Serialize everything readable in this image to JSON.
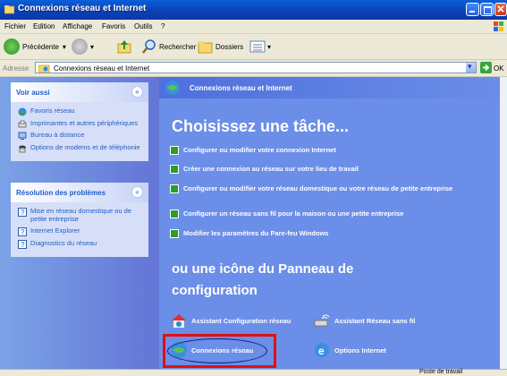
{
  "window": {
    "title": "Connexions réseau et Internet"
  },
  "menu": [
    "Fichier",
    "Edition",
    "Affichage",
    "Favoris",
    "Outils",
    "?"
  ],
  "toolbar": {
    "back_label": "Précédente",
    "search_label": "Rechercher",
    "folders_label": "Dossiers"
  },
  "address": {
    "label": "Adresse",
    "value": "Connexions réseau et Internet",
    "go_label": "OK"
  },
  "see_also": {
    "title": "Voir aussi",
    "items": [
      "Favoris réseau",
      "Imprimantes et autres périphériques",
      "Bureau à distance",
      "Options de modems et de téléphonie"
    ]
  },
  "troubleshoot": {
    "title": "Résolution des problèmes",
    "items": [
      "Mise en réseau domestique ou de petite entreprise",
      "Internet Explorer",
      "Diagnostics du réseau"
    ]
  },
  "main": {
    "header": "Connexions réseau et Internet",
    "task_title": "Choisissez une tâche...",
    "tasks": [
      "Configurer ou modifier votre connexion Internet",
      "Créer une connexion au réseau sur votre lieu de travail",
      "Configurer ou modifier votre réseau domestique ou votre réseau de petite entreprise",
      "Configurer un réseau sans fil pour la maison ou une petite entreprise",
      "Modifier les paramètres du Pare-feu Windows"
    ],
    "section2_title": "ou une icône du Panneau de configuration",
    "cp_items": [
      "Assistant Configuration réseau",
      "Assistant Réseau sans fil",
      "Connexions réseau",
      "Options Internet"
    ]
  },
  "status": {
    "text": "Poste de travail"
  }
}
